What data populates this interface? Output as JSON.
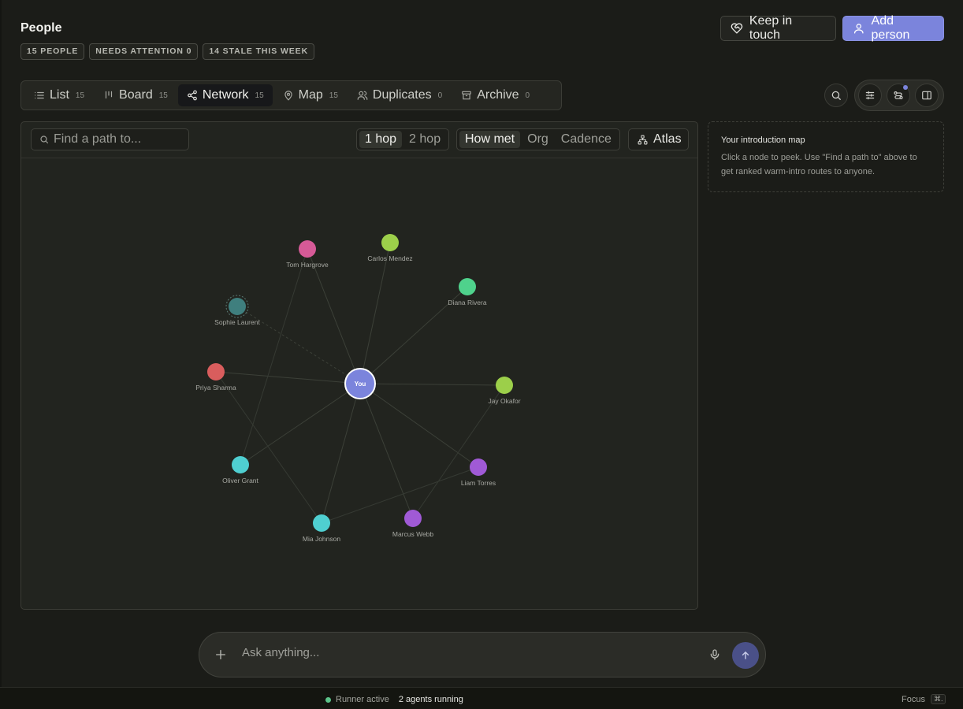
{
  "header": {
    "title": "People",
    "badges": [
      "15 PEOPLE",
      "NEEDS ATTENTION 0",
      "14 STALE THIS WEEK"
    ],
    "keep_in_touch_label": "Keep in touch",
    "add_person_label": "Add person"
  },
  "tabs": [
    {
      "label": "List",
      "count": "15",
      "icon": "list-icon"
    },
    {
      "label": "Board",
      "count": "15",
      "icon": "board-icon"
    },
    {
      "label": "Network",
      "count": "15",
      "icon": "share-icon",
      "active": true
    },
    {
      "label": "Map",
      "count": "15",
      "icon": "map-pin-icon"
    },
    {
      "label": "Duplicates",
      "count": "0",
      "icon": "users-icon"
    },
    {
      "label": "Archive",
      "count": "0",
      "icon": "archive-icon"
    }
  ],
  "graph": {
    "search_placeholder": "Find a path to...",
    "hop_options": [
      "1 hop",
      "2 hop"
    ],
    "hop_selected": "1 hop",
    "mode_options": [
      "How met",
      "Org",
      "Cadence"
    ],
    "mode_selected": "How met",
    "atlas_label": "Atlas",
    "center_label": "You",
    "center_color": "#7b84dc",
    "nodes": [
      {
        "name": "Tom Hargrove",
        "color": "#d65a97"
      },
      {
        "name": "Carlos Mendez",
        "color": "#9ccf4a"
      },
      {
        "name": "Diana Rivera",
        "color": "#4fd28c"
      },
      {
        "name": "Sophie Laurent",
        "color": "#3f7f7e",
        "dimmed": true
      },
      {
        "name": "Priya Sharma",
        "color": "#d95d5d"
      },
      {
        "name": "Jay Okafor",
        "color": "#9ccf4a"
      },
      {
        "name": "Oliver Grant",
        "color": "#4fcfd1"
      },
      {
        "name": "Liam Torres",
        "color": "#a05ad6"
      },
      {
        "name": "Mia Johnson",
        "color": "#4fcfd1"
      },
      {
        "name": "Marcus Webb",
        "color": "#a05ad6"
      }
    ]
  },
  "hint": {
    "title": "Your introduction map",
    "body": "Click a node to peek. Use \"Find a path to\" above to get ranked warm-intro routes to anyone."
  },
  "ask": {
    "placeholder": "Ask anything..."
  },
  "status": {
    "runner": "Runner active",
    "agents": "2 agents running",
    "focus": "Focus",
    "focus_key": "⌘."
  }
}
